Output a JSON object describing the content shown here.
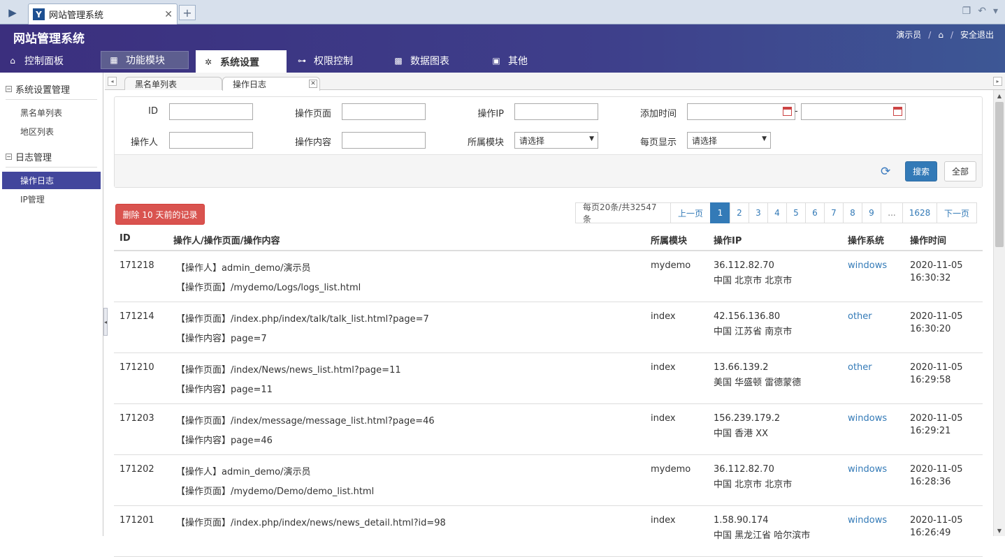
{
  "browser": {
    "tab_title": "网站管理系统",
    "tab_logo": "Y",
    "newtab": "+",
    "icons": [
      "sidebar-toggle-icon",
      "tab-group-icon",
      "undo-icon",
      "chevron-down-icon"
    ]
  },
  "header": {
    "title": "网站管理系统",
    "user": "演示员",
    "sep1": "/",
    "sep2": "/",
    "logout": "安全退出"
  },
  "nav": [
    {
      "label": "控制面板",
      "icon": "home-icon"
    },
    {
      "label": "功能模块",
      "icon": "modules-icon"
    },
    {
      "label": "系统设置",
      "icon": "settings-icon"
    },
    {
      "label": "权限控制",
      "icon": "key-icon"
    },
    {
      "label": "数据图表",
      "icon": "chart-icon"
    },
    {
      "label": "其他",
      "icon": "window-icon"
    }
  ],
  "sidebar": {
    "groups": [
      {
        "title": "系统设置管理",
        "items": [
          "黑名单列表",
          "地区列表"
        ]
      },
      {
        "title": "日志管理",
        "items": [
          "操作日志",
          "IP管理"
        ]
      }
    ],
    "active_item": "操作日志"
  },
  "content_tabs": [
    "黑名单列表",
    "操作日志"
  ],
  "search": {
    "labels": {
      "id": "ID",
      "page": "操作页面",
      "ip": "操作IP",
      "time": "添加时间",
      "operator": "操作人",
      "content": "操作内容",
      "module": "所属模块",
      "per_page": "每页显示"
    },
    "date_sep": "-",
    "module_value": "请选择",
    "per_page_value": "请选择",
    "search_btn": "搜索",
    "all_btn": "全部"
  },
  "delete_btn": "删除 10 天前的记录",
  "pager": {
    "info": "每页20条/共32547条",
    "prev": "上一页",
    "pages": [
      "1",
      "2",
      "3",
      "4",
      "5",
      "6",
      "7",
      "8",
      "9"
    ],
    "ellipsis": "...",
    "last": "1628",
    "next": "下一页",
    "current": "1"
  },
  "table": {
    "headers": {
      "id": "ID",
      "desc": "操作人/操作页面/操作内容",
      "module": "所属模块",
      "ip": "操作IP",
      "os": "操作系统",
      "time": "操作时间"
    },
    "rows": [
      {
        "id": "171218",
        "line1": "【操作人】admin_demo/演示员",
        "line2": "【操作页面】/mydemo/Logs/logs_list.html",
        "module": "mydemo",
        "ip": "36.112.82.70",
        "loc": "中国 北京市 北京市",
        "os": "windows",
        "date": "2020-11-05",
        "time": "16:30:32"
      },
      {
        "id": "171214",
        "line1": "【操作页面】/index.php/index/talk/talk_list.html?page=7",
        "line2": "【操作内容】page=7",
        "module": "index",
        "ip": "42.156.136.80",
        "loc": "中国 江苏省 南京市",
        "os": "other",
        "date": "2020-11-05",
        "time": "16:30:20"
      },
      {
        "id": "171210",
        "line1": "【操作页面】/index/News/news_list.html?page=11",
        "line2": "【操作内容】page=11",
        "module": "index",
        "ip": "13.66.139.2",
        "loc": "美国 华盛顿 雷德蒙德",
        "os": "other",
        "date": "2020-11-05",
        "time": "16:29:58"
      },
      {
        "id": "171203",
        "line1": "【操作页面】/index/message/message_list.html?page=46",
        "line2": "【操作内容】page=46",
        "module": "index",
        "ip": "156.239.179.2",
        "loc": "中国 香港 XX",
        "os": "windows",
        "date": "2020-11-05",
        "time": "16:29:21"
      },
      {
        "id": "171202",
        "line1": "【操作人】admin_demo/演示员",
        "line2": "【操作页面】/mydemo/Demo/demo_list.html",
        "module": "mydemo",
        "ip": "36.112.82.70",
        "loc": "中国 北京市 北京市",
        "os": "windows",
        "date": "2020-11-05",
        "time": "16:28:36"
      },
      {
        "id": "171201",
        "line1": "【操作页面】/index.php/index/news/news_detail.html?id=98",
        "line2": "",
        "module": "index",
        "ip": "1.58.90.174",
        "loc": "中国 黑龙江省 哈尔滨市",
        "os": "windows",
        "date": "2020-11-05",
        "time": "16:26:49"
      }
    ]
  }
}
